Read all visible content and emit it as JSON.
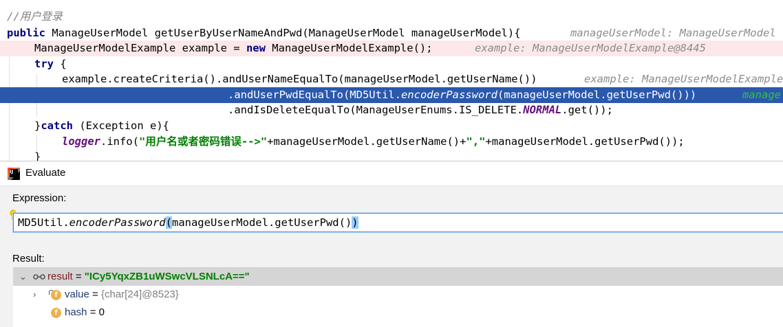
{
  "editor": {
    "comment": "//用户登录",
    "method_sig": {
      "kw_public": "public",
      "text": " ManageUserModel getUserByUserNameAndPwd(ManageUserModel manageUserModel){",
      "hint": "manageUserModel: ManageUserModel"
    },
    "line3": {
      "text_a": "ManageUserModelExample example = ",
      "kw_new": "new",
      "text_b": " ManageUserModelExample();",
      "hint": "example: ManageUserModelExample@8445"
    },
    "line4": {
      "kw_try": "try",
      "text": " {"
    },
    "line5": {
      "text": "example.createCriteria().andUserNameEqualTo(manageUserModel.getUserName())",
      "hint": "example: ManageUserModelExample"
    },
    "line6": {
      "text_a": ".andUserPwdEqualTo(MD5Util.",
      "ital": "encoderPassword",
      "text_b": "(manageUserModel.getUserPwd()))",
      "hint": "manage"
    },
    "line7": {
      "text_a": ".andIsDeleteEqualTo(ManageUserEnums.IS_DELETE.",
      "field": "NORMAL",
      "text_b": ".get());"
    },
    "line8": {
      "text_a": "}",
      "kw_catch": "catch",
      "text_b": " (Exception e){"
    },
    "line9": {
      "logger": "logger",
      "text_a": ".info(",
      "str": "\"用户名或者密码错误-->\"",
      "text_b": "+manageUserModel.getUserName()+",
      "str2": "\",\"",
      "text_c": "+manageUserModel.getUserPwd());"
    },
    "line10": {
      "text": "}"
    }
  },
  "dialog": {
    "title": "Evaluate",
    "expression_label": "Expression:",
    "expression": {
      "prefix": "MD5Util.",
      "method": "encoderPassword",
      "open_paren": "(",
      "args": "manageUserModel.getUserPwd()",
      "close_paren": ")"
    },
    "result_label": "Result:",
    "tree": [
      {
        "name": "result",
        "eq": " = ",
        "value": "\"ICy5YqxZB1uWSwcVLSNLcA==\""
      },
      {
        "name": "value",
        "eq": " = ",
        "value": "{char[24]@8523}"
      },
      {
        "name": "hash",
        "eq": " = ",
        "value": "0"
      }
    ],
    "icons": {
      "app": "intellij-idea-icon",
      "bulb": "lightbulb-icon",
      "watch": "watch-glasses-icon",
      "field": "field-f-icon",
      "expand": "chevron-right-icon"
    }
  }
}
